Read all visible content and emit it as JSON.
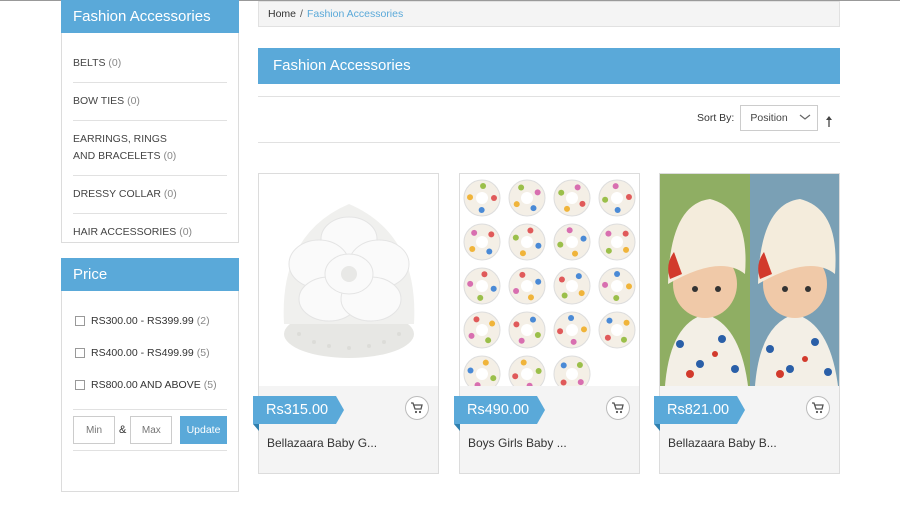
{
  "sidebar": {
    "categories_title": "Fashion Accessories",
    "categories": [
      {
        "label": "BELTS",
        "count": "(0)"
      },
      {
        "label": "BOW TIES",
        "count": "(0)"
      },
      {
        "label": "EARRINGS, RINGS AND BRACELETS",
        "count": "(0)"
      },
      {
        "label": "DRESSY COLLAR",
        "count": "(0)"
      },
      {
        "label": "HAIR ACCESSORIES",
        "count": "(0)"
      }
    ],
    "price_title": "Price",
    "price_ranges": [
      {
        "label": "RS300.00 - RS399.99",
        "count": "(2)"
      },
      {
        "label": "RS400.00 - RS499.99",
        "count": "(5)"
      },
      {
        "label": "RS800.00 AND ABOVE",
        "count": "(5)"
      }
    ],
    "min_placeholder": "Min",
    "amp": "&",
    "max_placeholder": "Max",
    "update_label": "Update"
  },
  "breadcrumb": {
    "home": "Home",
    "sep": "/",
    "current": "Fashion Accessories"
  },
  "main": {
    "title": "Fashion Accessories"
  },
  "sorter": {
    "label": "Sort By:",
    "selected": "Position",
    "direction_icon": "up-arrow-icon"
  },
  "products": [
    {
      "price": "Rs315.00",
      "name": "Bellazaara Baby G...",
      "image": "white-flower-beanie"
    },
    {
      "price": "Rs490.00",
      "name": "Boys Girls Baby ...",
      "image": "baby-scarves-grid"
    },
    {
      "price": "Rs821.00",
      "name": "Bellazaara Baby B...",
      "image": "baby-hat-photo"
    }
  ],
  "colors": {
    "accent": "#5aa9d9",
    "panel": "#f4f4f4",
    "border": "#dcdcdc"
  }
}
